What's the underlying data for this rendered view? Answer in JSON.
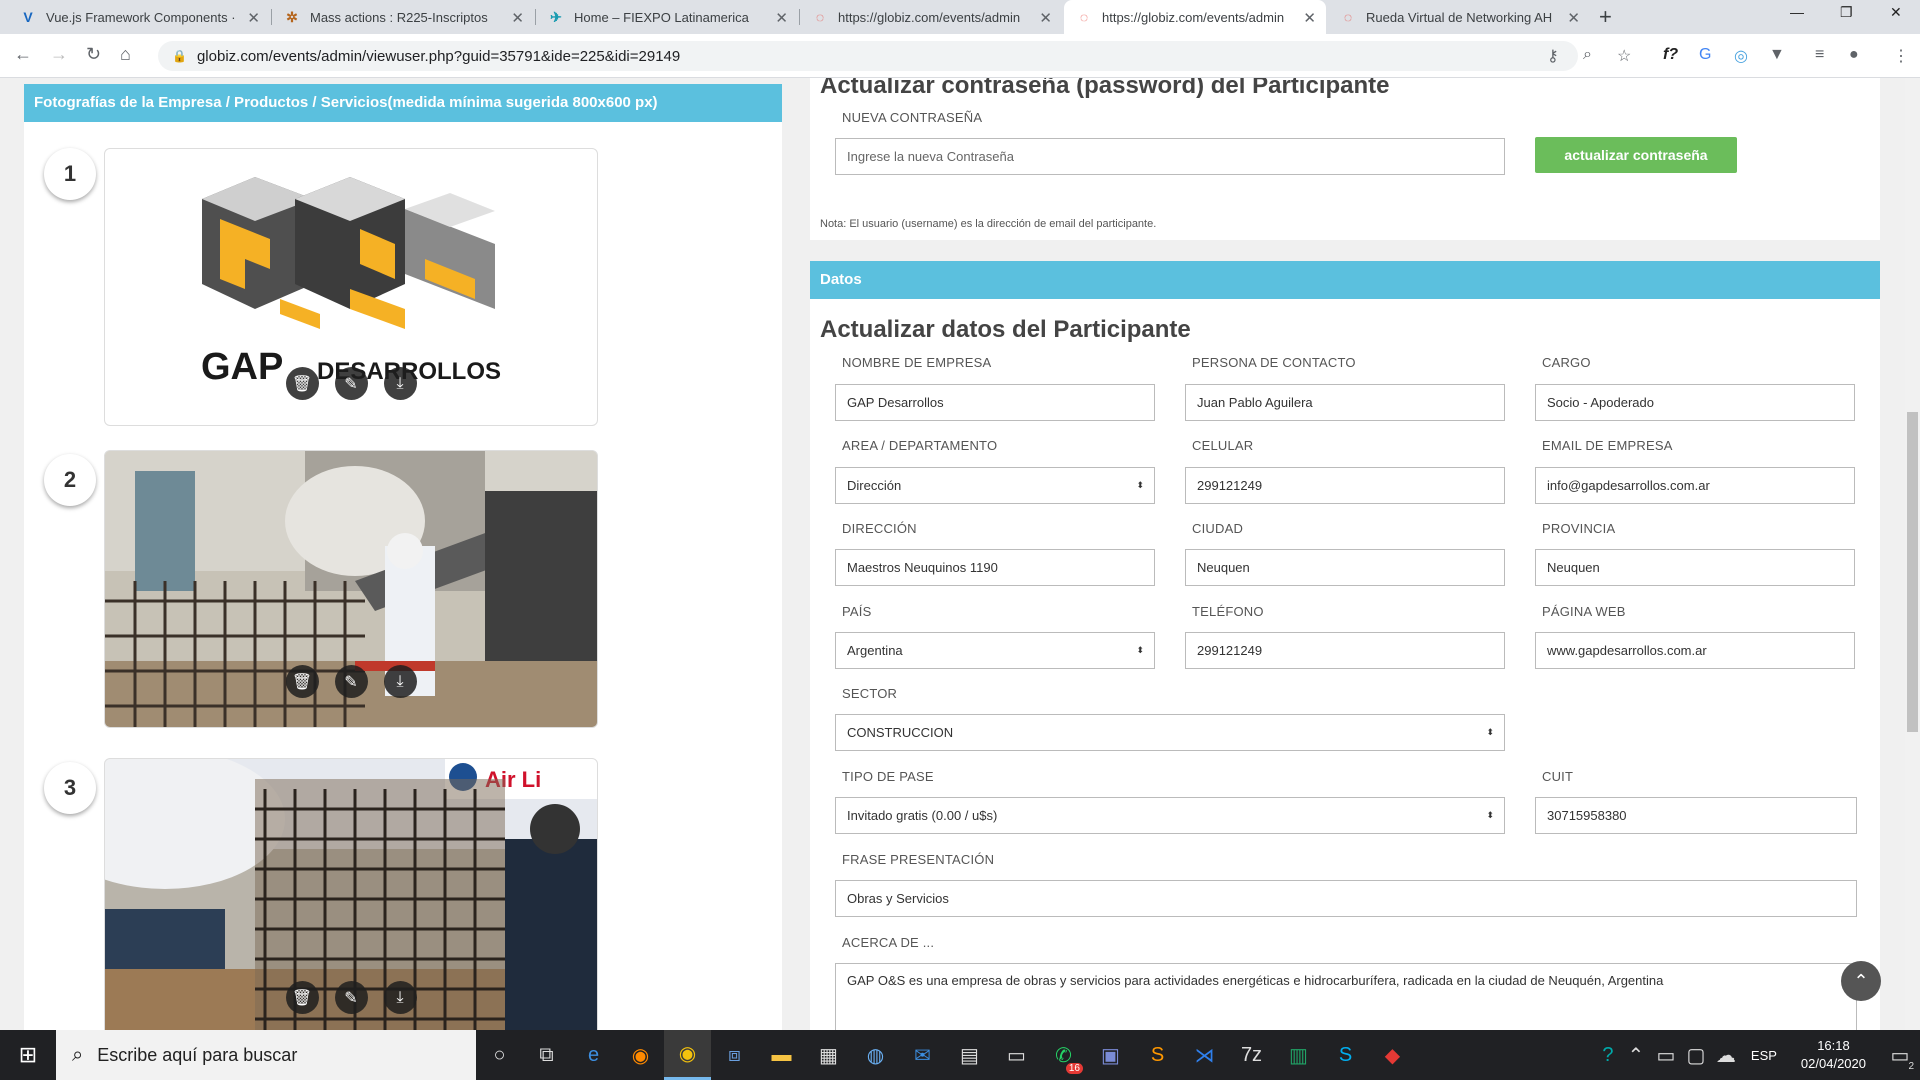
{
  "browser": {
    "tabs": [
      {
        "title": "Vue.js Framework Components ·",
        "icon": "vuetify-icon"
      },
      {
        "title": "Mass actions : R225-Inscriptos",
        "icon": "globiz-icon"
      },
      {
        "title": "Home – FIEXPO Latinamerica",
        "icon": "fiexpo-icon"
      },
      {
        "title": "https://globiz.com/events/admin",
        "icon": "loading-icon"
      },
      {
        "title": "https://globiz.com/events/admin",
        "icon": "loading-icon"
      },
      {
        "title": "Rueda Virtual de Networking AH",
        "icon": "loading-icon"
      }
    ],
    "url": "globiz.com/events/admin/viewuser.php?guid=35791&ide=225&idi=29149"
  },
  "photos": {
    "header": "Fotografías de la Empresa / Productos / Servicios(medida mínima sugerida 800x600 px)",
    "items": [
      {
        "num": "1",
        "logo_text_1": "GAP",
        "logo_text_2": "DESARROLLOS"
      },
      {
        "num": "2"
      },
      {
        "num": "3",
        "banner_text": "Air Li"
      }
    ]
  },
  "password": {
    "title": "Actualizar contraseña (password) del Participante",
    "label": "NUEVA CONTRASEÑA",
    "placeholder": "Ingrese la nueva Contraseña",
    "button": "actualizar contraseña",
    "note": "Nota: El usuario (username) es la dirección de email del participante."
  },
  "datos": {
    "bar": "Datos",
    "title": "Actualizar datos del Participante",
    "fields": {
      "empresa": {
        "label": "NOMBRE DE EMPRESA",
        "value": "GAP Desarrollos"
      },
      "contacto": {
        "label": "PERSONA DE CONTACTO",
        "value": "Juan Pablo Aguilera"
      },
      "cargo": {
        "label": "CARGO",
        "value": "Socio - Apoderado"
      },
      "area": {
        "label": "AREA / DEPARTAMENTO",
        "value": "Dirección"
      },
      "celular": {
        "label": "CELULAR",
        "value": "299121249"
      },
      "email": {
        "label": "EMAIL DE EMPRESA",
        "value": "info@gapdesarrollos.com.ar"
      },
      "direccion": {
        "label": "DIRECCIÓN",
        "value": "Maestros Neuquinos 1190"
      },
      "ciudad": {
        "label": "CIUDAD",
        "value": "Neuquen"
      },
      "provincia": {
        "label": "PROVINCIA",
        "value": "Neuquen"
      },
      "pais": {
        "label": "PAÍS",
        "value": "Argentina"
      },
      "telefono": {
        "label": "TELÉFONO",
        "value": "299121249"
      },
      "web": {
        "label": "PÁGINA WEB",
        "value": "www.gapdesarrollos.com.ar"
      },
      "sector": {
        "label": "SECTOR",
        "value": "CONSTRUCCION"
      },
      "pase": {
        "label": "TIPO DE PASE",
        "value": "Invitado gratis (0.00 / u$s)"
      },
      "cuit": {
        "label": "CUIT",
        "value": "30715958380"
      },
      "frase": {
        "label": "FRASE PRESENTACIÓN",
        "value": "Obras y Servicios"
      },
      "acerca": {
        "label": "ACERCA DE ...",
        "value": "GAP O&S es una empresa de obras y servicios para actividades energéticas e hidrocarburífera, radicada en la ciudad de Neuquén, Argentina"
      }
    }
  },
  "taskbar": {
    "search_placeholder": "Escribe aquí para buscar",
    "whatsapp_badge": "16",
    "lang": "ESP",
    "time": "16:18",
    "date": "02/04/2020",
    "notifications": "2"
  }
}
